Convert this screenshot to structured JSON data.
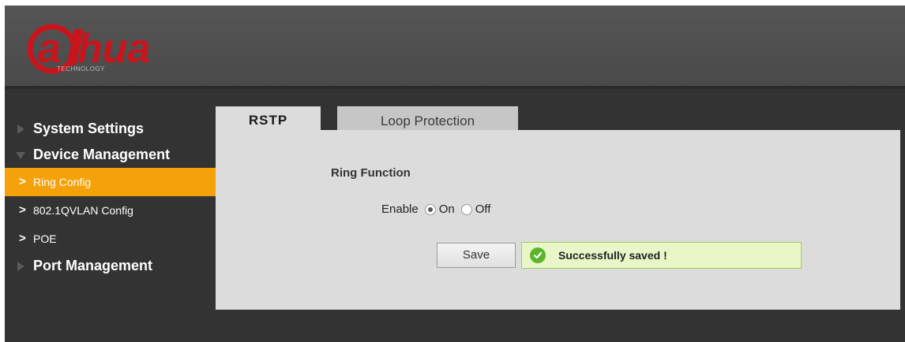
{
  "header": {
    "logo_text": "a hua",
    "logo_sub": "TECHNOLOGY"
  },
  "sidebar": {
    "groups": [
      {
        "label": "System Settings",
        "expanded": false
      },
      {
        "label": "Device Management",
        "expanded": true,
        "items": [
          {
            "label": "Ring Config",
            "active": true
          },
          {
            "label": "802.1QVLAN Config",
            "active": false
          },
          {
            "label": "POE",
            "active": false
          }
        ]
      },
      {
        "label": "Port Management",
        "expanded": false
      }
    ]
  },
  "tabs": [
    {
      "label": "RSTP",
      "active": true
    },
    {
      "label": "Loop Protection",
      "active": false
    }
  ],
  "form": {
    "section_title": "Ring Function",
    "enable_label": "Enable",
    "on_label": "On",
    "off_label": "Off",
    "selected": "On",
    "save_label": "Save"
  },
  "toast": {
    "message": "Successfully saved !"
  },
  "colors": {
    "active_nav": "#f5a20a",
    "brand": "#c8151d",
    "success": "#5cb52b"
  }
}
